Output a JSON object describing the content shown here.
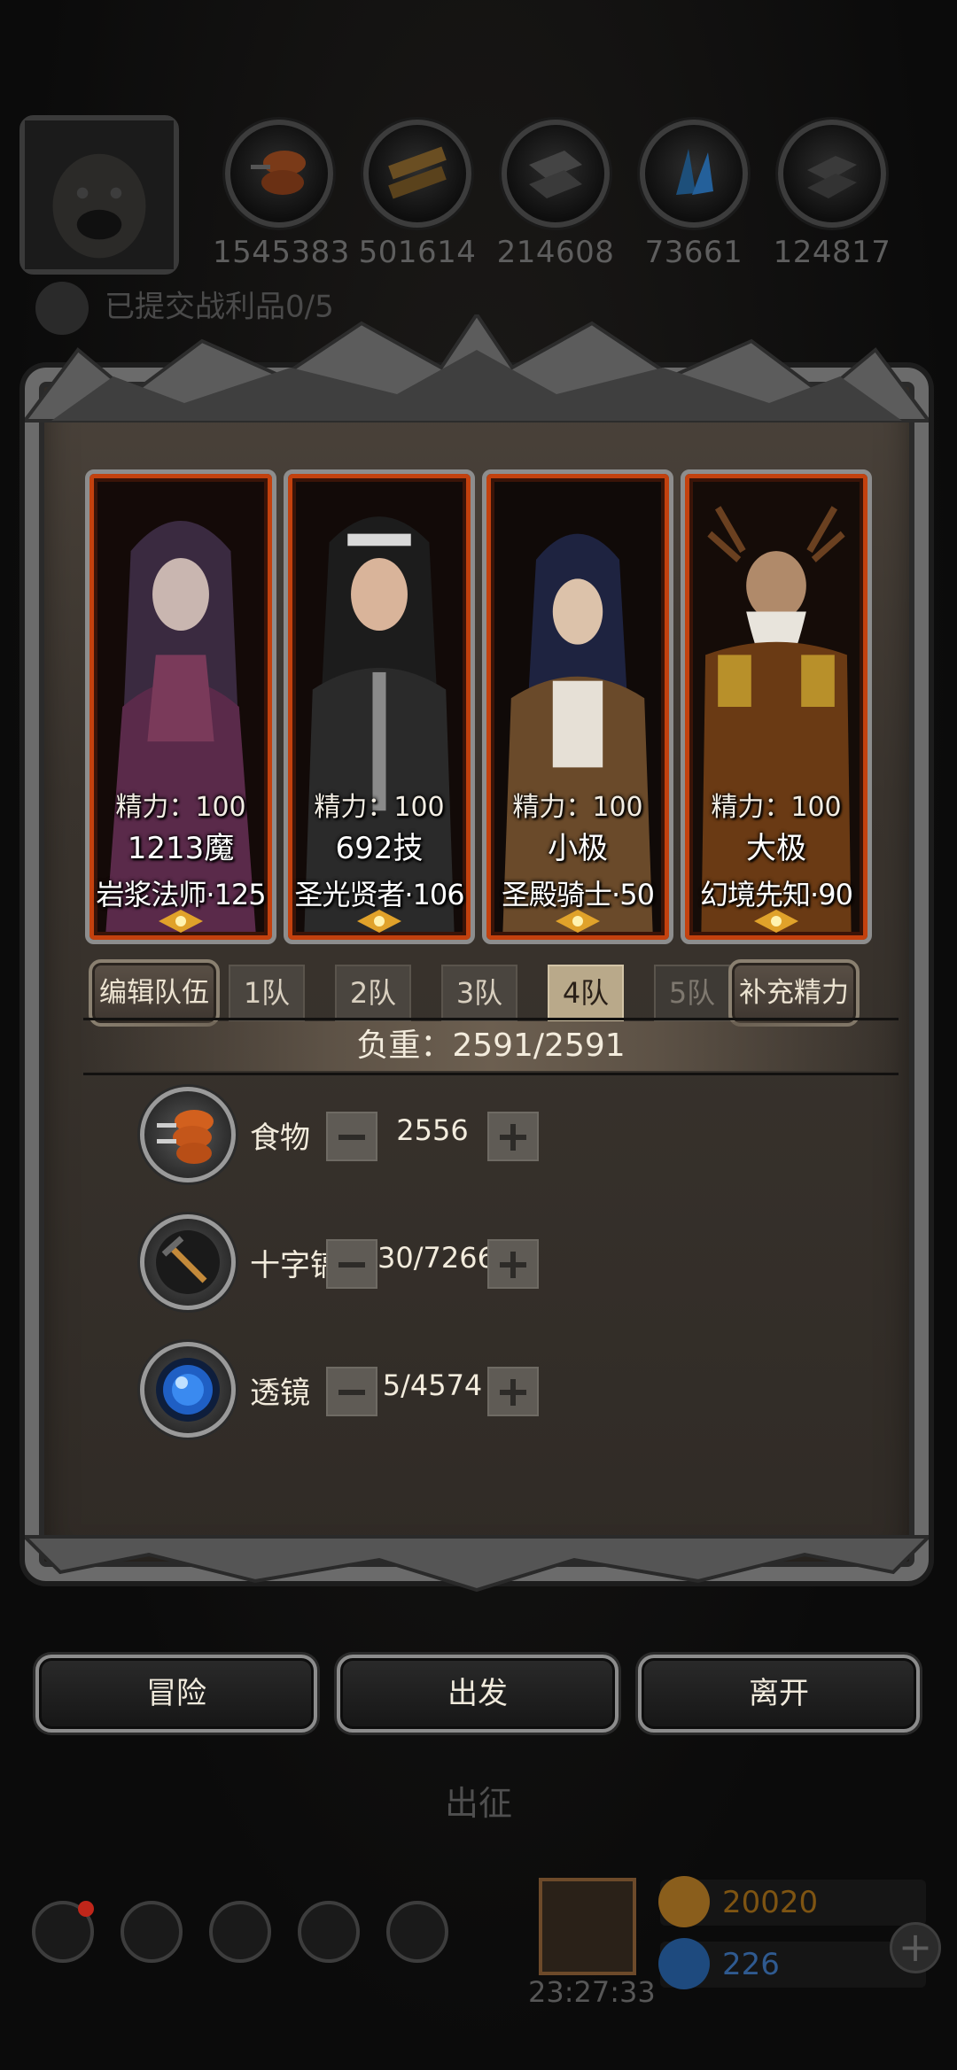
{
  "resources": [
    {
      "icon": "meat-icon",
      "value": "1545383"
    },
    {
      "icon": "wood-icon",
      "value": "501614"
    },
    {
      "icon": "stone-icon",
      "value": "214608"
    },
    {
      "icon": "crystal-icon",
      "value": "73661"
    },
    {
      "icon": "iron-icon",
      "value": "124817"
    }
  ],
  "battle_log": "已提交战利品0/5",
  "heroes": [
    {
      "stamina": "精力：100",
      "level": "1213魔",
      "class": "岩浆法师·125"
    },
    {
      "stamina": "精力：100",
      "level": "692技",
      "class": "圣光贤者·106"
    },
    {
      "stamina": "精力：100",
      "level": "小极",
      "class": "圣殿骑士·50"
    },
    {
      "stamina": "精力：100",
      "level": "大极",
      "class": "幻境先知·90"
    }
  ],
  "team_bar": {
    "edit": "编辑队伍",
    "tabs": [
      "1队",
      "2队",
      "3队",
      "4队",
      "5队"
    ],
    "active_tab": "4队",
    "refill": "补充精力"
  },
  "weight": "负重：2591/2591",
  "supplies": [
    {
      "icon": "meat-icon",
      "name": "食物",
      "value": "2556"
    },
    {
      "icon": "pickaxe-icon",
      "name": "十字镐",
      "value": "30/7266"
    },
    {
      "icon": "lens-icon",
      "name": "透镜",
      "value": "5/4574"
    }
  ],
  "actions": {
    "adventure": "冒险",
    "depart": "出发",
    "leave": "离开"
  },
  "expedition_label": "出征",
  "timer": "23:27:33",
  "currency": {
    "gold": "20020",
    "gems": "226"
  },
  "colors": {
    "gold": "#c98a2a",
    "gem": "#3a7bd5",
    "hero_border": "#c3410e",
    "active_tab": "#b9a98a"
  }
}
